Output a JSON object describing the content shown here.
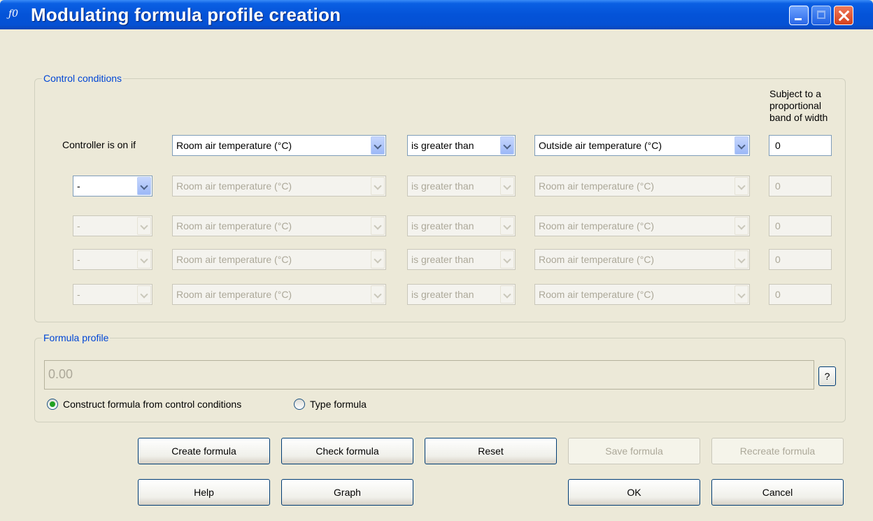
{
  "window": {
    "title": "Modulating formula profile creation",
    "icon": "function-icon"
  },
  "control_conditions": {
    "legend": "Control conditions",
    "band_header": "Subject to a proportional band of width",
    "row_label": "Controller is on if",
    "rows": [
      {
        "logic": "",
        "variable": "Room air temperature (°C)",
        "operator": "is greater than",
        "compare": "Outside air temperature (°C)",
        "band": "0"
      },
      {
        "logic": "-",
        "variable": "Room air temperature (°C)",
        "operator": "is greater than",
        "compare": "Room air temperature (°C)",
        "band": "0"
      },
      {
        "logic": "-",
        "variable": "Room air temperature (°C)",
        "operator": "is greater than",
        "compare": "Room air temperature (°C)",
        "band": "0"
      },
      {
        "logic": "-",
        "variable": "Room air temperature (°C)",
        "operator": "is greater than",
        "compare": "Room air temperature (°C)",
        "band": "0"
      },
      {
        "logic": "-",
        "variable": "Room air temperature (°C)",
        "operator": "is greater than",
        "compare": "Room air temperature (°C)",
        "band": "0"
      }
    ]
  },
  "formula_profile": {
    "legend": "Formula profile",
    "value": "0.00",
    "help_label": "?",
    "radio_construct": "Construct formula from control conditions",
    "radio_type": "Type formula",
    "selected": "construct"
  },
  "buttons": {
    "create": "Create formula",
    "check": "Check formula",
    "reset": "Reset",
    "save": "Save formula",
    "recreate": "Recreate formula",
    "help": "Help",
    "graph": "Graph",
    "ok": "OK",
    "cancel": "Cancel"
  }
}
